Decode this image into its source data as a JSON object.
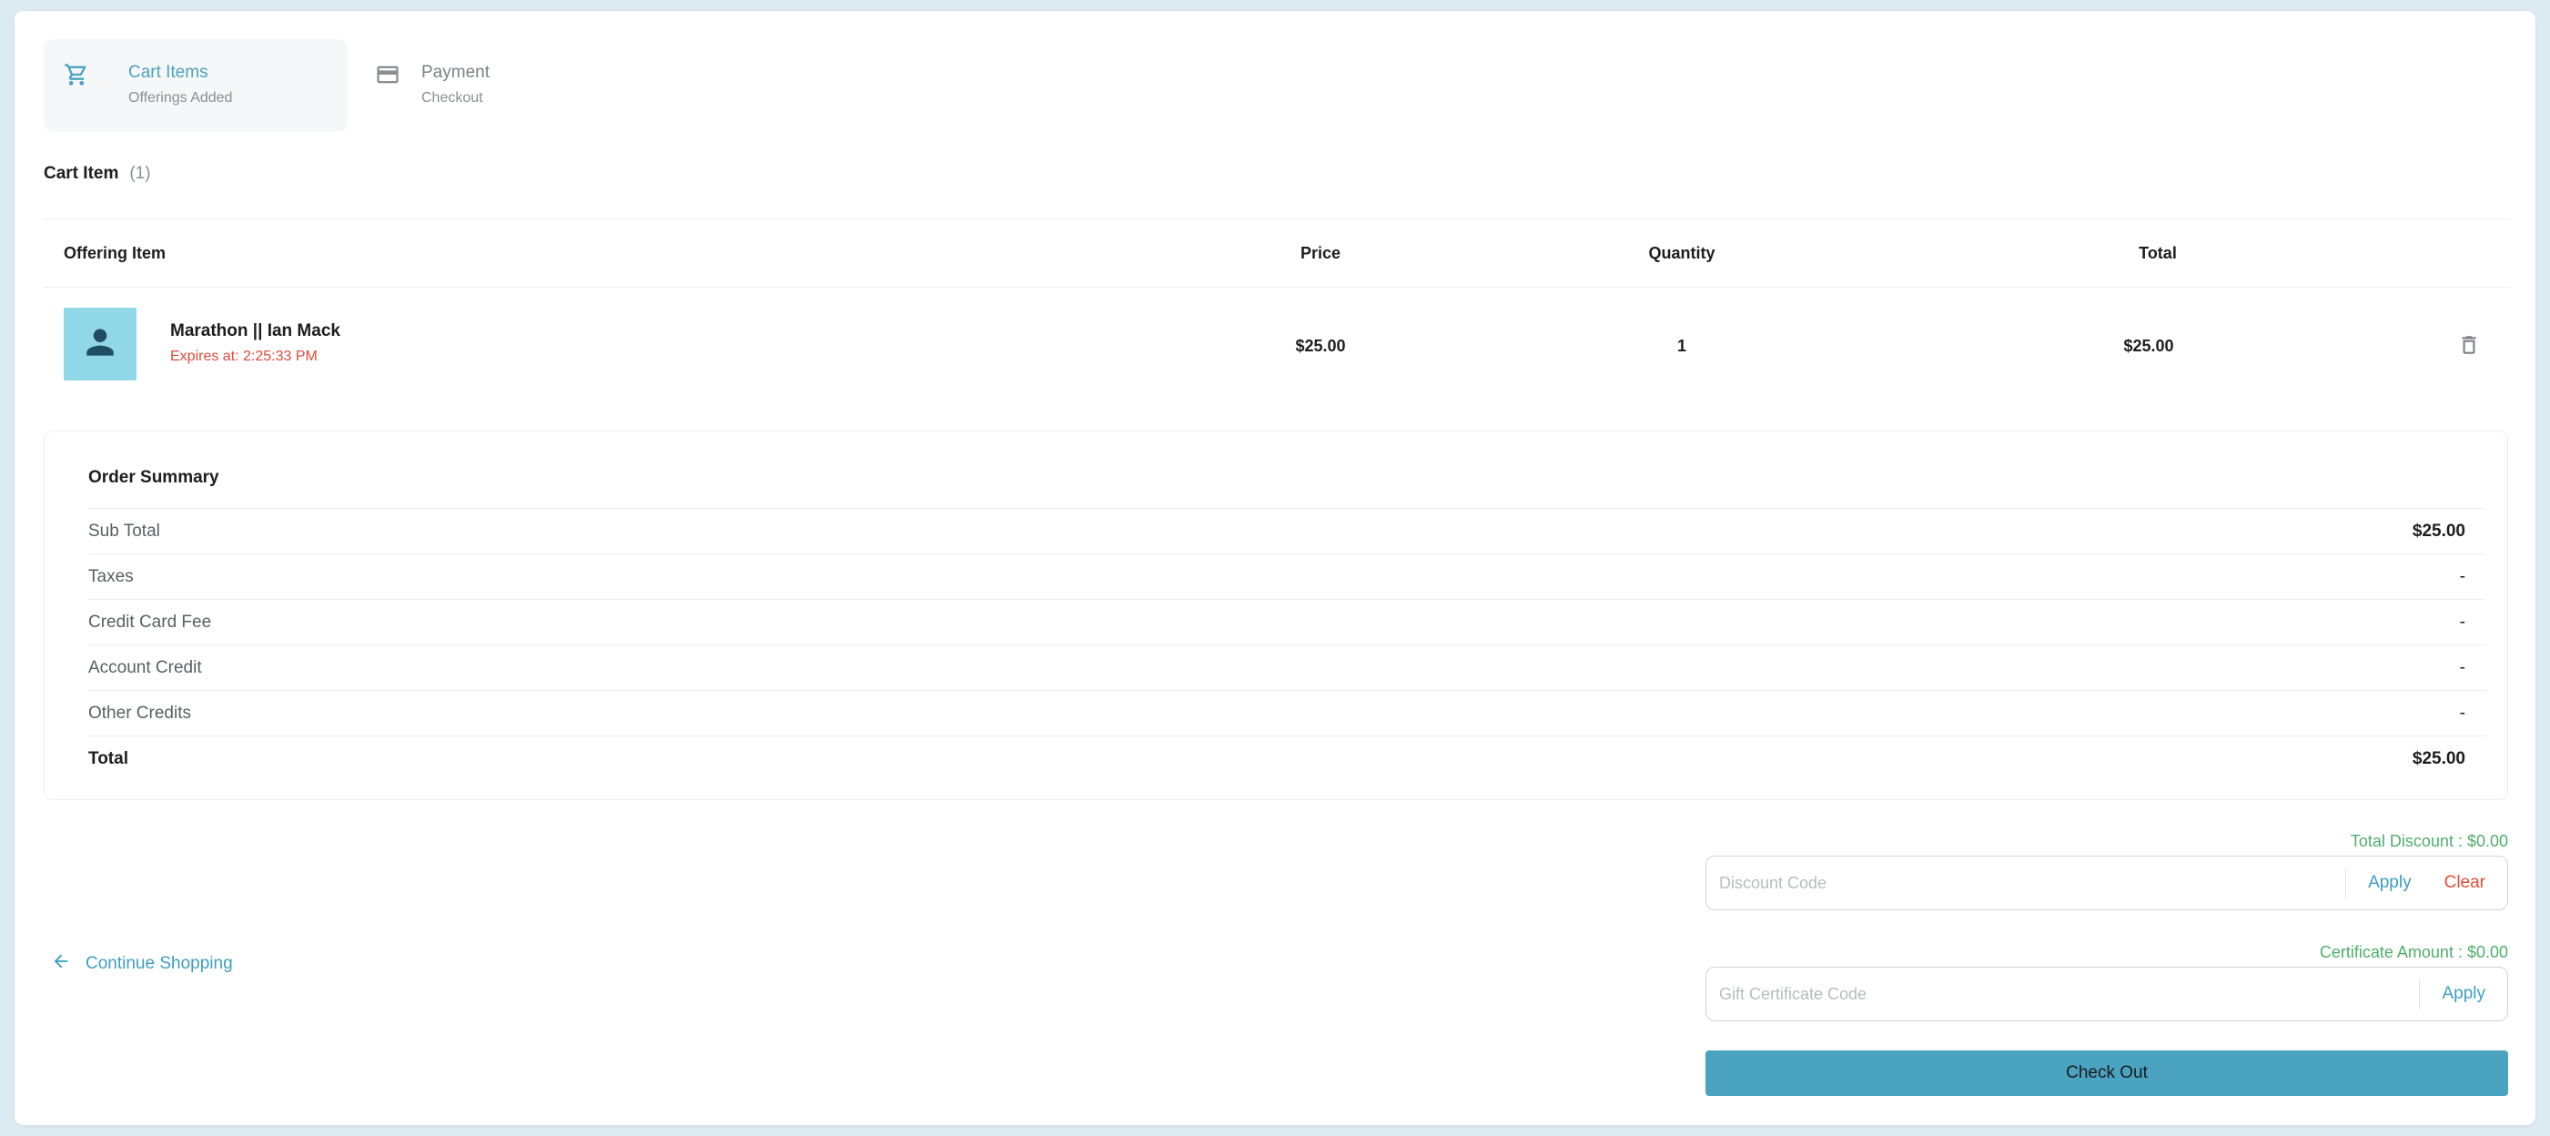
{
  "steps": [
    {
      "title": "Cart Items",
      "subtitle": "Offerings Added"
    },
    {
      "title": "Payment",
      "subtitle": "Checkout"
    }
  ],
  "cart": {
    "heading": "Cart Item",
    "count": "(1)"
  },
  "table": {
    "headers": {
      "item": "Offering Item",
      "price": "Price",
      "quantity": "Quantity",
      "total": "Total"
    },
    "rows": [
      {
        "name": "Marathon || Ian Mack",
        "expires": "Expires at: 2:25:33 PM",
        "price": "$25.00",
        "quantity": "1",
        "total": "$25.00"
      }
    ]
  },
  "summary": {
    "title": "Order Summary",
    "rows": [
      {
        "label": "Sub Total",
        "value": "$25.00"
      },
      {
        "label": "Taxes",
        "value": "-"
      },
      {
        "label": "Credit Card Fee",
        "value": "-"
      },
      {
        "label": "Account Credit",
        "value": "-"
      },
      {
        "label": "Other Credits",
        "value": "-"
      },
      {
        "label": "Total",
        "value": "$25.00"
      }
    ]
  },
  "continue_label": "Continue Shopping",
  "discount": {
    "label": "Total Discount :  $0.00",
    "placeholder": "Discount Code",
    "apply": "Apply",
    "clear": "Clear"
  },
  "gift": {
    "label": "Certificate Amount :  $0.00",
    "placeholder": "Gift Certificate Code",
    "apply": "Apply"
  },
  "checkout_label": "Check Out",
  "colors": {
    "accent": "#4aa3c0",
    "danger": "#e04a3a",
    "success": "#4fae6a"
  }
}
